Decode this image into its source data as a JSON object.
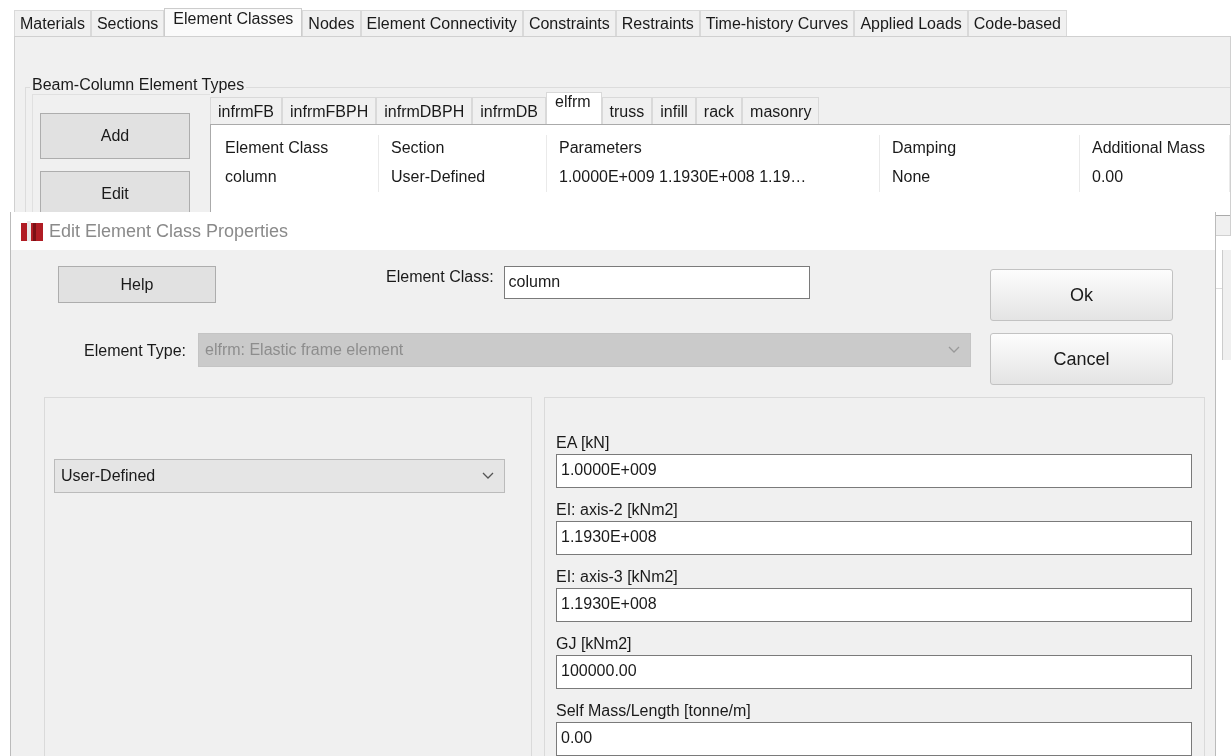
{
  "main_tabs": [
    {
      "label": "Materials",
      "selected": false
    },
    {
      "label": "Sections",
      "selected": false
    },
    {
      "label": "Element Classes",
      "selected": true
    },
    {
      "label": "Nodes",
      "selected": false
    },
    {
      "label": "Element Connectivity",
      "selected": false
    },
    {
      "label": "Constraints",
      "selected": false
    },
    {
      "label": "Restraints",
      "selected": false
    },
    {
      "label": "Time-history Curves",
      "selected": false
    },
    {
      "label": "Applied Loads",
      "selected": false
    },
    {
      "label": "Code-based",
      "selected": false
    }
  ],
  "group_title": "Beam-Column Element Types",
  "side_buttons": [
    "Add",
    "Edit"
  ],
  "type_tabs": [
    {
      "label": "infrmFB",
      "selected": false
    },
    {
      "label": "infrmFBPH",
      "selected": false
    },
    {
      "label": "infrmDBPH",
      "selected": false
    },
    {
      "label": "infrmDB",
      "selected": false
    },
    {
      "label": "elfrm",
      "selected": true
    },
    {
      "label": "truss",
      "selected": false
    },
    {
      "label": "infill",
      "selected": false
    },
    {
      "label": "rack",
      "selected": false
    },
    {
      "label": "masonry",
      "selected": false
    }
  ],
  "table": {
    "columns": [
      "Element Class",
      "Section",
      "Parameters",
      "Damping",
      "Additional Mass"
    ],
    "rows": [
      [
        "column",
        "User-Defined",
        "1.0000E+009  1.1930E+008  1.19…",
        "None",
        "0.00"
      ]
    ]
  },
  "dialog": {
    "title": "Edit Element Class Properties",
    "help_button": "Help",
    "element_class": {
      "label": "Element Class:",
      "value": "column"
    },
    "element_type": {
      "label": "Element Type:",
      "value": "elfrm: Elastic frame element",
      "disabled": true
    },
    "buttons": [
      "Ok",
      "Cancel"
    ],
    "section_select": {
      "value": "User-Defined"
    },
    "fields": [
      {
        "label": "EA [kN]",
        "value": "1.0000E+009"
      },
      {
        "label": "EI: axis-2 [kNm2]",
        "value": "1.1930E+008"
      },
      {
        "label": "EI: axis-3 [kNm2]",
        "value": "1.1930E+008"
      },
      {
        "label": "GJ [kNm2]",
        "value": "100000.00"
      },
      {
        "label": "Self Mass/Length [tonne/m]",
        "value": "0.00"
      }
    ]
  }
}
